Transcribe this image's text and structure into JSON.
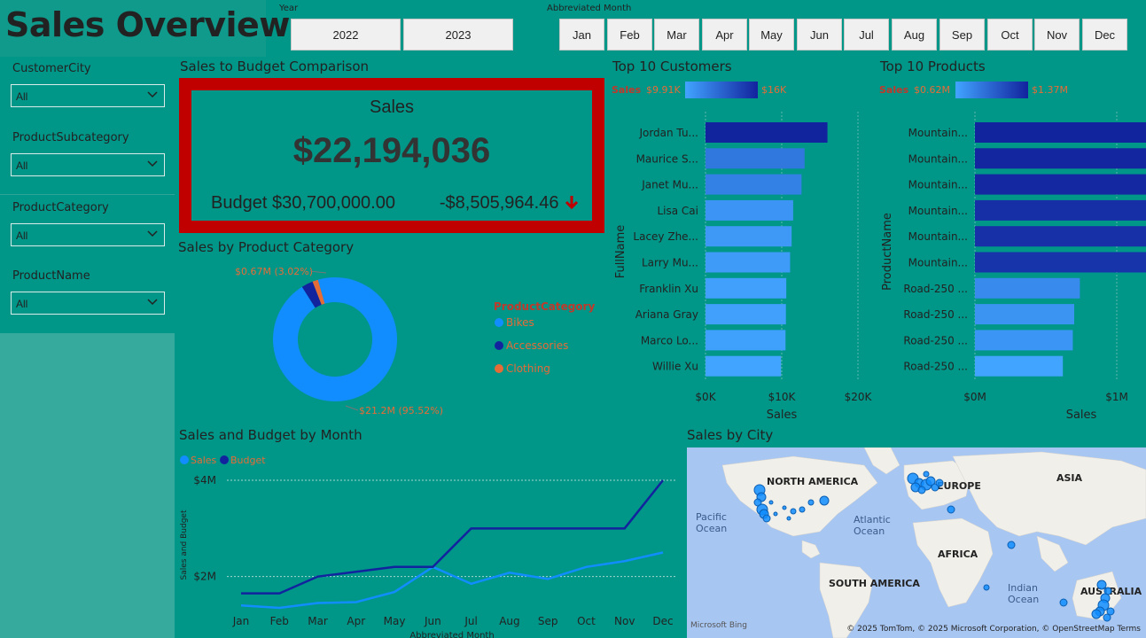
{
  "header": {
    "title": "Sales Overview"
  },
  "year_slicer": {
    "caption": "Year",
    "options": [
      "2022",
      "2023"
    ]
  },
  "month_slicer": {
    "caption": "Abbreviated Month",
    "options": [
      "Jan",
      "Feb",
      "Mar",
      "Apr",
      "May",
      "Jun",
      "Jul",
      "Aug",
      "Sep",
      "Oct",
      "Nov",
      "Dec"
    ]
  },
  "filters": [
    {
      "label": "CustomerCity",
      "value": "All"
    },
    {
      "label": "ProductSubcategory",
      "value": "All"
    },
    {
      "label": "ProductCategory",
      "value": "All"
    },
    {
      "label": "ProductName",
      "value": "All"
    }
  ],
  "kpi": {
    "section_title": "Sales to Budget Comparison",
    "label": "Sales",
    "value": "$22,194,036",
    "budget": "Budget $30,700,000.00",
    "variance": "-$8,505,964.46",
    "variance_arrow": "🡓",
    "border_color": "#c00000"
  },
  "colors": {
    "bikes": "#118dff",
    "accessories": "#12239e",
    "clothing": "#e66c37",
    "sales_line": "#118dff",
    "budget_line": "#12239e"
  },
  "chart_data": [
    {
      "type": "pie",
      "title": "Sales by Product Category",
      "legend_title": "ProductCategory",
      "legend_position": "right",
      "categories": [
        "Bikes",
        "Accessories",
        "Clothing"
      ],
      "values": [
        21.2,
        0.67,
        0.32
      ],
      "colors": [
        "#118dff",
        "#12239e",
        "#e66c37"
      ],
      "labels": [
        "$21.2M (95.52%)",
        "$0.67M (3.02%)",
        ""
      ]
    },
    {
      "type": "bar",
      "title": "Top 10 Customers",
      "xlabel": "Sales",
      "ylabel": "FullName",
      "legend_label": "Sales",
      "gradient_min": "$9.91K",
      "gradient_max": "$16K",
      "categories": [
        "Jordan Tu...",
        "Maurice S...",
        "Janet Mu...",
        "Lisa Cai",
        "Lacey Zhe...",
        "Larry Mu...",
        "Franklin Xu",
        "Ariana Gray",
        "Marco Lo...",
        "Willie Xu"
      ],
      "values": [
        16000,
        13000,
        12600,
        11500,
        11300,
        11100,
        10600,
        10550,
        10500,
        9910
      ],
      "xticks": [
        "$0K",
        "$10K",
        "$20K"
      ],
      "xlim": [
        0,
        20000
      ]
    },
    {
      "type": "bar",
      "title": "Top 10 Products",
      "xlabel": "Sales",
      "ylabel": "ProductName",
      "legend_label": "Sales",
      "gradient_min": "$0.62M",
      "gradient_max": "$1.37M",
      "categories": [
        "Mountain...",
        "Mountain...",
        "Mountain...",
        "Mountain...",
        "Mountain...",
        "Mountain...",
        "Road-250 ...",
        "Road-250 ...",
        "Road-250 ...",
        "Road-250 ..."
      ],
      "values": [
        1370000,
        1360000,
        1340000,
        1300000,
        1290000,
        1260000,
        740000,
        700000,
        690000,
        620000
      ],
      "xticks": [
        "$0M",
        "$1M"
      ],
      "xlim": [
        0,
        1500000
      ]
    },
    {
      "type": "line",
      "title": "Sales and Budget by Month",
      "xlabel": "Abbreviated Month",
      "ylabel": "Sales and Budget",
      "x": [
        "Jan",
        "Feb",
        "Mar",
        "Apr",
        "May",
        "Jun",
        "Jul",
        "Aug",
        "Sep",
        "Oct",
        "Nov",
        "Dec"
      ],
      "series": [
        {
          "name": "Sales",
          "values": [
            1.4,
            1.35,
            1.45,
            1.47,
            1.68,
            2.2,
            1.85,
            2.08,
            1.95,
            2.2,
            2.32,
            2.5
          ]
        },
        {
          "name": "Budget",
          "values": [
            1.65,
            1.65,
            2.0,
            2.1,
            2.2,
            2.2,
            3.0,
            3.0,
            3.0,
            3.0,
            3.0,
            4.0
          ]
        }
      ],
      "yticks": [
        "$2M",
        "$4M"
      ],
      "ylim": [
        1.0,
        4.0
      ]
    }
  ],
  "map": {
    "title": "Sales by City",
    "labels": [
      "NORTH AMERICA",
      "EUROPE",
      "ASIA",
      "AFRICA",
      "SOUTH AMERICA",
      "AUSTRALIA",
      "Pacific Ocean",
      "Atlantic Ocean",
      "Indian Ocean"
    ],
    "attribution": "© 2025 TomTom, © 2025 Microsoft Corporation, © OpenStreetMap  Terms",
    "provider": "Microsoft Bing"
  }
}
